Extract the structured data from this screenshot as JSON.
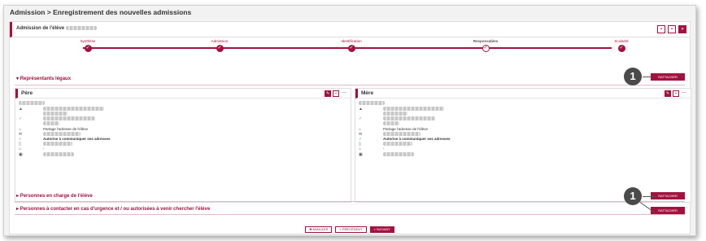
{
  "page": {
    "title": "Admission > Enregistrement des nouvelles admissions"
  },
  "admission": {
    "label": "Admission de l'élève"
  },
  "header_buttons": [
    "▪",
    "▪",
    "»"
  ],
  "steps": [
    {
      "label": "Synthèse",
      "state": "done",
      "glyph": "✓"
    },
    {
      "label": "Admission",
      "state": "done",
      "glyph": "✓"
    },
    {
      "label": "Identification",
      "state": "done",
      "glyph": "✓"
    },
    {
      "label": "Responsables",
      "state": "active",
      "glyph": "✓"
    },
    {
      "label": "Scolarité",
      "state": "done",
      "glyph": "✓"
    }
  ],
  "sections": {
    "representants": "Représentants légaux",
    "personnes_charge": "Personnes en charge de l'élève",
    "personnes_contact": "Personnes à contacter en cas d'urgence et / ou autorisées à venir chercher l'élève"
  },
  "buttons": {
    "rattacher": "RATTACHER",
    "annuler": "✖ ANNULER",
    "precedent": "« PRÉCÉDENT",
    "suivant": "» SUIVANT"
  },
  "callouts": [
    "1",
    "1"
  ],
  "cards": {
    "pere": {
      "name": "Père",
      "icons": {
        "partage": "home-icon",
        "email": "envelope-icon",
        "autorise": "check-icon"
      },
      "partage": "Partage l'adresse de l'élève",
      "autorise": "Autorise à communiquer ses adresses",
      "tel_fixe": "-"
    },
    "mere": {
      "name": "Mère",
      "partage": "Partage l'adresse de l'élève",
      "autorise": "Autorise à communiquer ses adresses",
      "tel_fixe": "-"
    }
  },
  "colors": {
    "accent": "#a3123f"
  }
}
